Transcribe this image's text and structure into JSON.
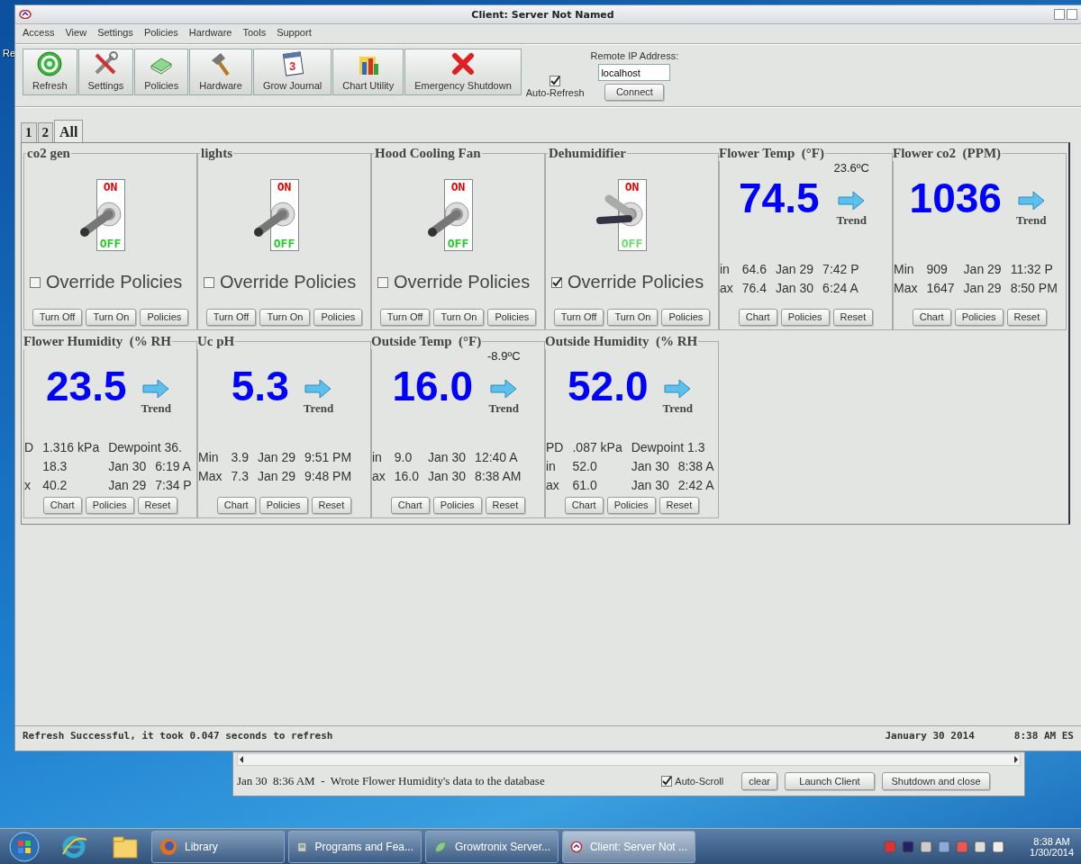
{
  "window": {
    "title": "Client: Server Not Named"
  },
  "menu": [
    "Access",
    "View",
    "Settings",
    "Policies",
    "Hardware",
    "Tools",
    "Support"
  ],
  "toolbar": [
    {
      "label": "Refresh"
    },
    {
      "label": "Settings"
    },
    {
      "label": "Policies"
    },
    {
      "label": "Hardware"
    },
    {
      "label": "Grow Journal",
      "icon_text": "3"
    },
    {
      "label": "Chart Utility"
    },
    {
      "label": "Emergency Shutdown"
    }
  ],
  "auto_refresh": {
    "label": "Auto-Refresh",
    "checked": true
  },
  "remote_ip": {
    "label": "Remote IP Address:",
    "value": "localhost",
    "button": "Connect"
  },
  "tabs": [
    {
      "label": "1",
      "selected": false
    },
    {
      "label": "2",
      "selected": false
    },
    {
      "label": "All",
      "selected": true
    }
  ],
  "panels": [
    {
      "kind": "switch",
      "title": "co2 gen",
      "on_label": "ON",
      "off_label": "OFF",
      "on": false,
      "override": {
        "label": "Override Policies",
        "checked": false
      },
      "buttons": [
        "Turn Off",
        "Turn On",
        "Policies"
      ]
    },
    {
      "kind": "switch",
      "title": "lights",
      "on_label": "ON",
      "off_label": "OFF",
      "on": false,
      "override": {
        "label": "Override Policies",
        "checked": false
      },
      "buttons": [
        "Turn Off",
        "Turn On",
        "Policies"
      ]
    },
    {
      "kind": "switch",
      "title": "Hood Cooling Fan",
      "on_label": "ON",
      "off_label": "OFF",
      "on": false,
      "override": {
        "label": "Override Policies",
        "checked": false
      },
      "buttons": [
        "Turn Off",
        "Turn On",
        "Policies"
      ]
    },
    {
      "kind": "switch",
      "title": "Dehumidifier",
      "on_label": "ON",
      "off_label": "OFF",
      "on": true,
      "override": {
        "label": "Override Policies",
        "checked": true
      },
      "buttons": [
        "Turn Off",
        "Turn On",
        "Policies"
      ]
    },
    {
      "kind": "sensor",
      "title": "Flower Temp  (°F)",
      "celsius": "23.6ºC",
      "value": "74.5",
      "trend": "Trend",
      "stats": [
        {
          "label": "in",
          "value": "64.6",
          "date": "Jan 29",
          "time": "7:42 P"
        },
        {
          "label": "ax",
          "value": "76.4",
          "date": "Jan 30",
          "time": "6:24 A"
        }
      ],
      "buttons": [
        "Chart",
        "Policies",
        "Reset"
      ]
    },
    {
      "kind": "sensor",
      "title": "Flower co2  (PPM)",
      "value": "1036",
      "trend": "Trend",
      "stats": [
        {
          "label": "Min",
          "value": "909",
          "date": "Jan 29",
          "time": "11:32 P"
        },
        {
          "label": "Max",
          "value": "1647",
          "date": "Jan 29",
          "time": "8:50 PM"
        }
      ],
      "buttons": [
        "Chart",
        "Policies",
        "Reset"
      ]
    },
    {
      "kind": "sensor",
      "title": "Flower Humidity  (% RH",
      "value": "23.5",
      "trend": "Trend",
      "stats": [
        {
          "label": "D",
          "value": "1.316 kPa",
          "dewpoint": "Dewpoint 36."
        },
        {
          "value": "18.3",
          "date": "Jan 30",
          "time": "6:19 A"
        },
        {
          "label": "x",
          "value": "40.2",
          "date": "Jan 29",
          "time": "7:34 P"
        }
      ],
      "buttons": [
        "Chart",
        "Policies",
        "Reset"
      ]
    },
    {
      "kind": "sensor",
      "title": "Uc pH",
      "value": "5.3",
      "trend": "Trend",
      "stats": [
        {
          "label": "Min",
          "value": "3.9",
          "date": "Jan 29",
          "time": "9:51 PM"
        },
        {
          "label": "Max",
          "value": "7.3",
          "date": "Jan 29",
          "time": "9:48 PM"
        }
      ],
      "buttons": [
        "Chart",
        "Policies",
        "Reset"
      ]
    },
    {
      "kind": "sensor",
      "title": "Outside Temp  (°F)",
      "celsius": "-8.9ºC",
      "value": "16.0",
      "trend": "Trend",
      "stats": [
        {
          "label": "in",
          "value": "9.0",
          "date": "Jan 30",
          "time": "12:40 A"
        },
        {
          "label": "ax",
          "value": "16.0",
          "date": "Jan 30",
          "time": "8:38 AM"
        }
      ],
      "buttons": [
        "Chart",
        "Policies",
        "Reset"
      ]
    },
    {
      "kind": "sensor",
      "title": "Outside Humidity  (% RH",
      "value": "52.0",
      "trend": "Trend",
      "stats": [
        {
          "label": "PD",
          "value": ".087 kPa",
          "dewpoint": "Dewpoint 1.3"
        },
        {
          "label": "in",
          "value": "52.0",
          "date": "Jan 30",
          "time": "8:38 A"
        },
        {
          "label": "ax",
          "value": "61.0",
          "date": "Jan 30",
          "time": "2:42 A"
        }
      ],
      "buttons": [
        "Chart",
        "Policies",
        "Reset"
      ]
    }
  ],
  "status_bar": {
    "message": "Refresh Successful, it took 0.047 seconds to refresh",
    "date": "January 30 2014",
    "time": "8:38 AM ES"
  },
  "server_window": {
    "log": "Jan 30  8:36 AM  -  Wrote Flower Humidity's data to the database",
    "auto_scroll": {
      "label": "Auto-Scroll",
      "checked": true
    },
    "buttons": [
      "clear",
      "Launch Client",
      "Shutdown and close"
    ]
  },
  "taskbar": {
    "tasks": [
      {
        "label": "Library",
        "selected": false
      },
      {
        "label": "Programs and Fea...",
        "selected": false
      },
      {
        "label": "Growtronix Server...",
        "selected": false
      },
      {
        "label": "Client: Server Not ...",
        "selected": true
      }
    ],
    "clock": {
      "time": "8:38 AM",
      "date": "1/30/2014"
    }
  },
  "desktop": {
    "icon_labels": [
      "Re"
    ]
  }
}
